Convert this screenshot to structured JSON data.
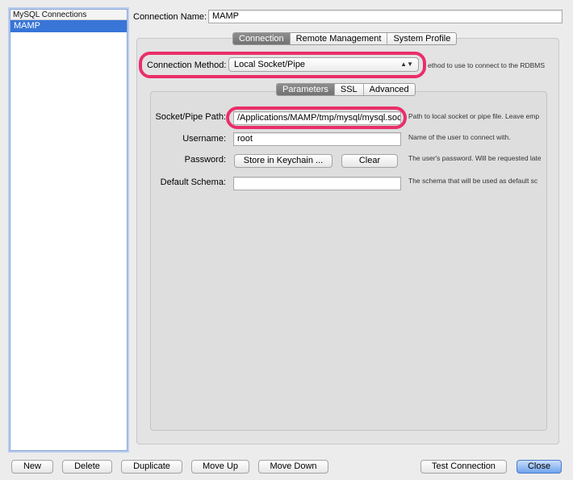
{
  "connections": {
    "header": "MySQL Connections",
    "items": [
      {
        "label": "MAMP",
        "selected": true
      }
    ]
  },
  "connection_name": {
    "label": "Connection Name:",
    "value": "MAMP"
  },
  "main_tabs": [
    {
      "label": "Connection",
      "active": true
    },
    {
      "label": "Remote Management",
      "active": false
    },
    {
      "label": "System Profile",
      "active": false
    }
  ],
  "connection_method": {
    "label": "Connection Method:",
    "value": "Local Socket/Pipe",
    "hint": "ethod to use to connect to the RDBMS"
  },
  "sub_tabs": [
    {
      "label": "Parameters",
      "active": true
    },
    {
      "label": "SSL",
      "active": false
    },
    {
      "label": "Advanced",
      "active": false
    }
  ],
  "params": {
    "socket": {
      "label": "Socket/Pipe Path:",
      "value": "/Applications/MAMP/tmp/mysql/mysql.soc",
      "hint": "Path to local socket or pipe file. Leave emp"
    },
    "username": {
      "label": "Username:",
      "value": "root",
      "hint": "Name of the user to connect with."
    },
    "password": {
      "label": "Password:",
      "store_label": "Store in Keychain ...",
      "clear_label": "Clear",
      "hint": "The user's password. Will be requested late"
    },
    "schema": {
      "label": "Default Schema:",
      "value": "",
      "hint": "The schema that will be used as default sc"
    }
  },
  "bottom_buttons": {
    "new": "New",
    "delete": "Delete",
    "duplicate": "Duplicate",
    "move_up": "Move Up",
    "move_down": "Move Down",
    "test_connection": "Test Connection",
    "close": "Close"
  },
  "colors": {
    "selection": "#3875d7",
    "highlight": "#ea2e6a",
    "primary_button": "#6fa4ec"
  }
}
